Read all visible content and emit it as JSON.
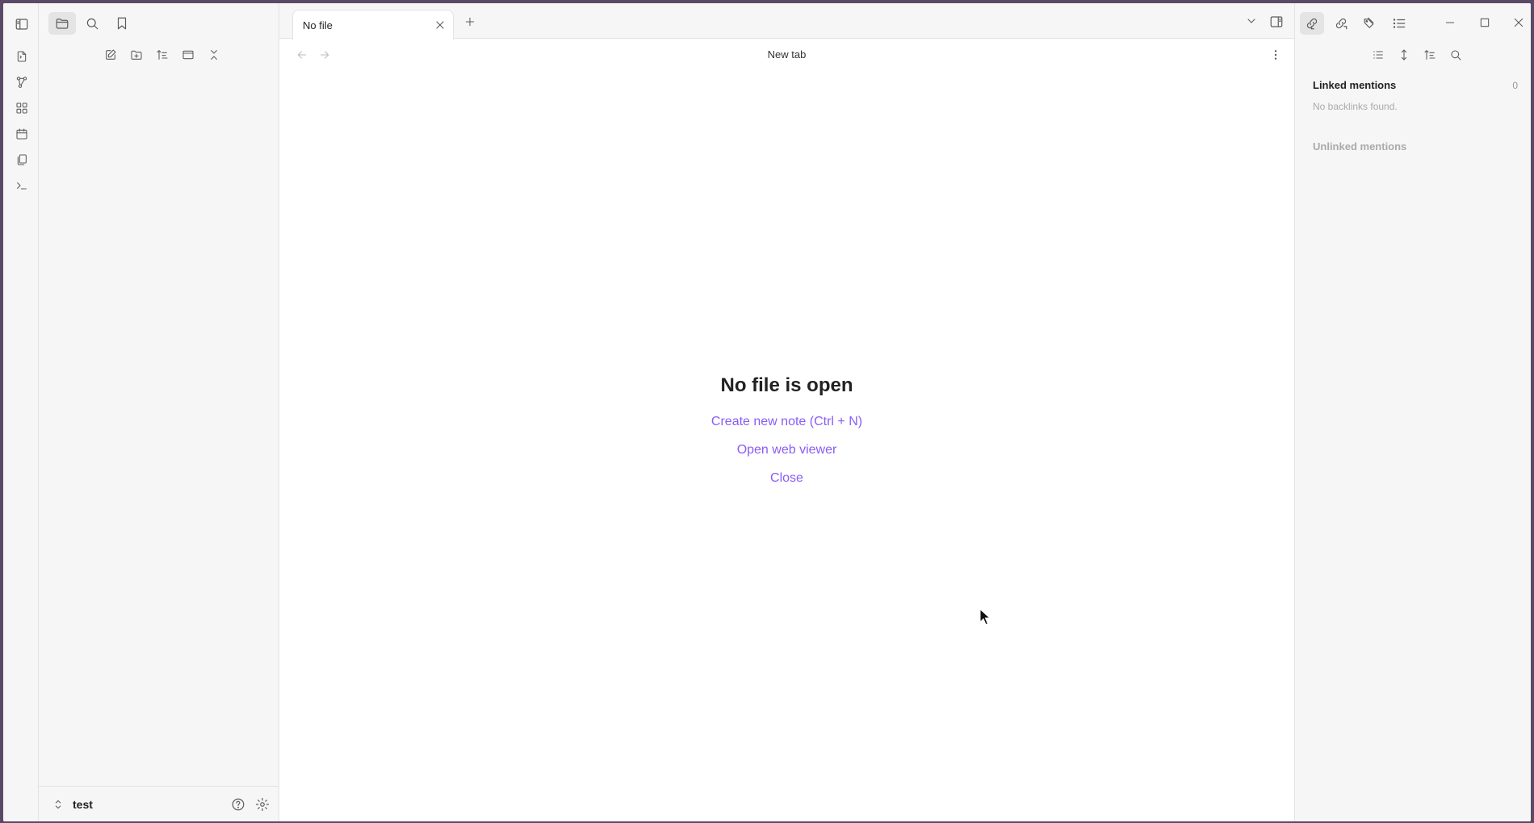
{
  "tabbar": {
    "active_tab_title": "No file"
  },
  "view": {
    "title": "New tab"
  },
  "empty_state": {
    "heading": "No file is open",
    "actions": [
      "Create new note (Ctrl + N)",
      "Open web viewer",
      "Close"
    ]
  },
  "sidebar": {
    "vault_name": "test"
  },
  "backlinks": {
    "linked_title": "Linked mentions",
    "linked_count": "0",
    "linked_empty": "No backlinks found.",
    "unlinked_title": "Unlinked mentions"
  },
  "colors": {
    "accent": "#8a5cf5",
    "panel_bg": "#f6f6f6",
    "border": "#e3e3e3"
  },
  "icons": {
    "ribbon": [
      "quick-switcher-icon",
      "graph-icon",
      "canvas-icon",
      "calendar-icon",
      "templates-icon",
      "terminal-icon"
    ],
    "sidebar_tabs": [
      "folder-icon",
      "search-icon",
      "bookmark-icon"
    ],
    "file_toolbar": [
      "new-note-icon",
      "new-folder-icon",
      "sort-icon",
      "collapse-panel-icon",
      "collapse-all-icon"
    ],
    "right_tabs": [
      "backlinks-icon",
      "outgoing-links-icon",
      "tags-icon",
      "outline-icon"
    ],
    "backlink_tools": [
      "list-icon",
      "expand-icon",
      "sort-icon",
      "search-icon"
    ]
  }
}
